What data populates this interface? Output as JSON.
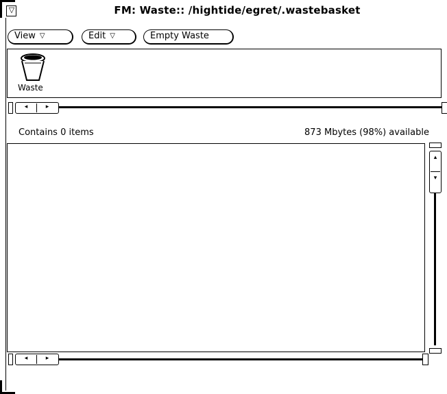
{
  "window": {
    "title": "FM: Waste:: /hightide/egret/.wastebasket",
    "menu_glyph": "▽"
  },
  "controls": {
    "view_label": "View",
    "edit_label": "Edit",
    "empty_label": "Empty Waste",
    "menu_arrow": "▽"
  },
  "icon_pane": {
    "items": [
      {
        "label": "Waste",
        "icon": "wastebasket-icon"
      }
    ]
  },
  "status": {
    "left": "Contains 0 items",
    "right": "873 Mbytes (98%) available"
  },
  "scroll": {
    "left_arrow": "◂",
    "right_arrow": "▸",
    "up_arrow": "▴",
    "down_arrow": "▾"
  }
}
